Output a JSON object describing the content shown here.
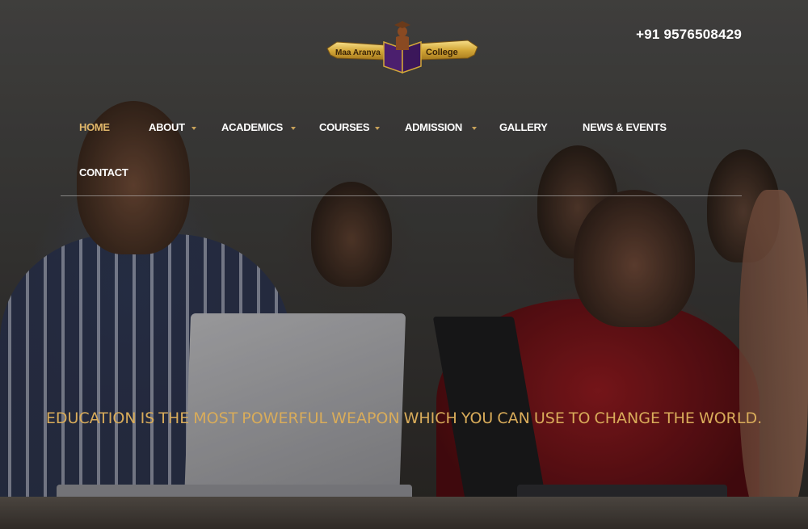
{
  "header": {
    "logo": {
      "left_text": "Maa Aranya",
      "right_text": "College",
      "icon": "graduate-book-icon"
    },
    "phone": "+91 9576508429"
  },
  "nav": {
    "items": [
      {
        "label": "HOME",
        "active": true,
        "dropdown": false
      },
      {
        "label": "ABOUT",
        "active": false,
        "dropdown": true
      },
      {
        "label": "ACADEMICS",
        "active": false,
        "dropdown": true
      },
      {
        "label": "COURSES",
        "active": false,
        "dropdown": true
      },
      {
        "label": "ADMISSION",
        "active": false,
        "dropdown": true
      },
      {
        "label": "GALLERY",
        "active": false,
        "dropdown": false
      },
      {
        "label": "NEWS & EVENTS",
        "active": false,
        "dropdown": false
      },
      {
        "label": "CONTACT",
        "active": false,
        "dropdown": false
      }
    ]
  },
  "hero": {
    "quote": "EDUCATION IS THE MOST POWERFUL WEAPON WHICH YOU CAN USE TO CHANGE THE WORLD."
  },
  "colors": {
    "accent": "#d9ac5a",
    "active_nav": "#e0b76a",
    "text": "#ffffff"
  }
}
